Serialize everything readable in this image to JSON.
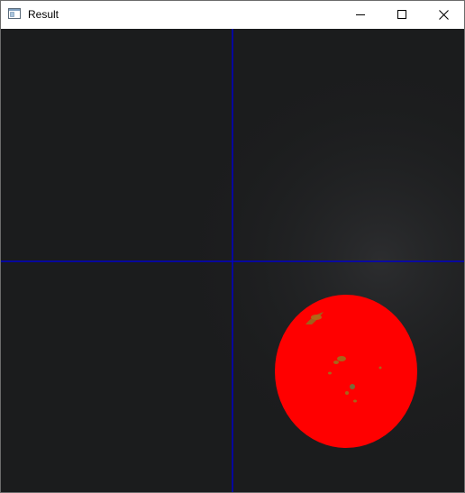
{
  "window": {
    "title": "Result",
    "icon": "app-window-icon",
    "controls": {
      "minimize_icon": "minimize-icon",
      "maximize_icon": "maximize-icon",
      "close_icon": "close-icon"
    }
  },
  "image": {
    "background_color": "#1b1c1d",
    "crosshair_color": "#0000c8",
    "detected_object_color": "#ff0000",
    "object_speckle_color": "#a0601a"
  }
}
